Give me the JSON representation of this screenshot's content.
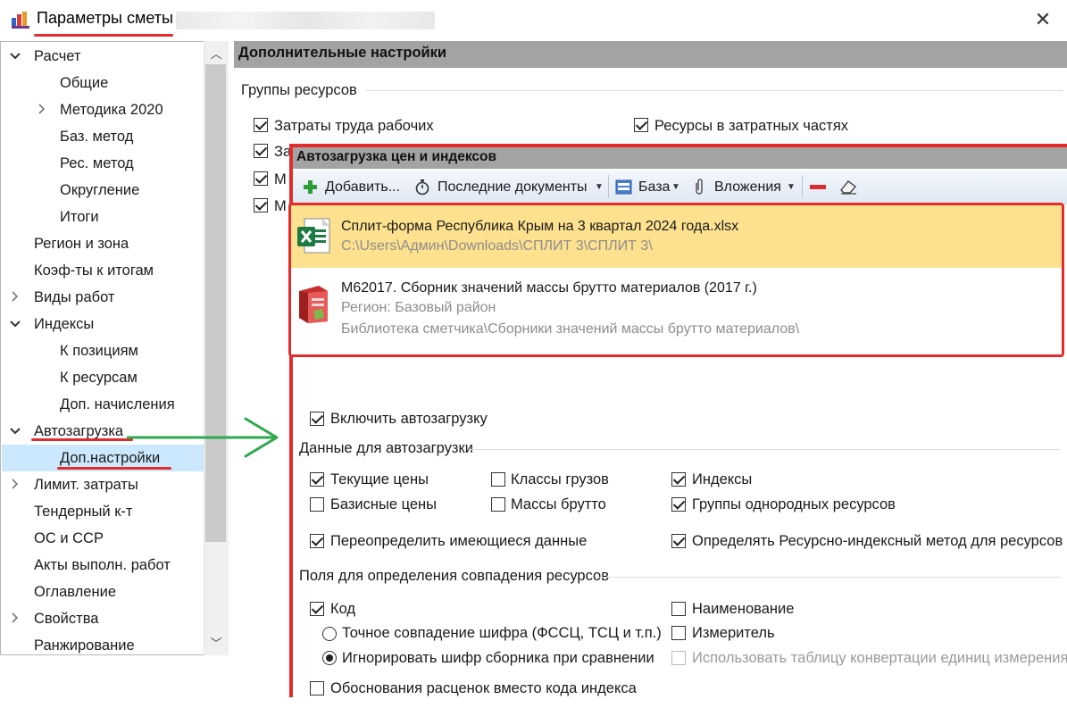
{
  "window": {
    "title": "Параметры сметы",
    "close_glyph": "✕"
  },
  "tree": {
    "items": [
      {
        "label": "Расчет",
        "level": 0,
        "expander": "expanded"
      },
      {
        "label": "Общие",
        "level": 1,
        "expander": "none"
      },
      {
        "label": "Методика 2020",
        "level": 1,
        "expander": "collapsed"
      },
      {
        "label": "Баз. метод",
        "level": 1,
        "expander": "none"
      },
      {
        "label": "Рес. метод",
        "level": 1,
        "expander": "none"
      },
      {
        "label": "Округление",
        "level": 1,
        "expander": "none"
      },
      {
        "label": "Итоги",
        "level": 1,
        "expander": "none"
      },
      {
        "label": "Регион и зона",
        "level": 0,
        "expander": "none"
      },
      {
        "label": "Коэф-ты к итогам",
        "level": 0,
        "expander": "none"
      },
      {
        "label": "Виды работ",
        "level": 0,
        "expander": "collapsed"
      },
      {
        "label": "Индексы",
        "level": 0,
        "expander": "expanded"
      },
      {
        "label": "К позициям",
        "level": 1,
        "expander": "none"
      },
      {
        "label": "К ресурсам",
        "level": 1,
        "expander": "none"
      },
      {
        "label": "Доп. начисления",
        "level": 1,
        "expander": "none"
      },
      {
        "label": "Автозагрузка",
        "level": 0,
        "expander": "expanded"
      },
      {
        "label": "Доп.настройки",
        "level": 1,
        "expander": "none",
        "selected": true
      },
      {
        "label": "Лимит. затраты",
        "level": 0,
        "expander": "collapsed"
      },
      {
        "label": "Тендерный к-т",
        "level": 0,
        "expander": "none"
      },
      {
        "label": "ОС и ССР",
        "level": 0,
        "expander": "none"
      },
      {
        "label": "Акты выполн. работ",
        "level": 0,
        "expander": "none"
      },
      {
        "label": "Оглавление",
        "level": 0,
        "expander": "none"
      },
      {
        "label": "Свойства",
        "level": 0,
        "expander": "collapsed"
      },
      {
        "label": "Ранжирование",
        "level": 0,
        "expander": "none"
      }
    ]
  },
  "panel": {
    "title": "Дополнительные настройки",
    "resource_groups_label": "Группы ресурсов",
    "labor_costs": "Затраты труда рабочих",
    "resources_in_cost_parts": "Ресурсы в затратных частях",
    "partial_za": "За",
    "partial_m": "М"
  },
  "overlay": {
    "title": "Автозагрузка цен и индексов",
    "toolbar": {
      "add": "Добавить...",
      "recent": "Последние документы",
      "base": "База",
      "attachments": "Вложения"
    },
    "files": [
      {
        "title": "Сплит-форма Республика Крым на 3 квартал 2024 года.xlsx",
        "path": "C:\\Users\\Админ\\Downloads\\СПЛИТ 3\\СПЛИТ 3\\",
        "icon": "excel-file-icon"
      },
      {
        "title": "М62017. Сборник значений массы брутто материалов (2017 г.)",
        "region": "Регион: Базовый район",
        "library": "Библиотека сметчика\\Сборники значений массы брутто материалов\\",
        "icon": "book-icon"
      }
    ],
    "enable_autoload": "Включить автозагрузку",
    "autoload_data_label": "Данные для автозагрузки",
    "current_prices": "Текущие цены",
    "base_prices": "Базисные цены",
    "cargo_classes": "Классы грузов",
    "gross_mass": "Массы брутто",
    "indexes": "Индексы",
    "homogeneous_groups": "Группы однородных ресурсов",
    "redefine_existing": "Переопределить имеющиеся данные",
    "define_resource_index": "Определять Ресурсно-индексный метод для ресурсов",
    "match_fields_label": "Поля для определения совпадения ресурсов",
    "code": "Код",
    "name": "Наименование",
    "exact_match": "Точное совпадение шифра (ФССЦ, ТСЦ и т.п.)",
    "measure": "Измеритель",
    "ignore_code": "Игнорировать шифр сборника при сравнении",
    "use_conversion_table": "Использовать таблицу конвертации единиц измерения",
    "justification_instead": "Обоснования расценок вместо кода индекса"
  },
  "colors": {
    "annotation_red": "#e32b2b",
    "annotation_green": "#2fa84f",
    "selected_item": "#fde18f",
    "header_gray": "#a3a3a3"
  }
}
